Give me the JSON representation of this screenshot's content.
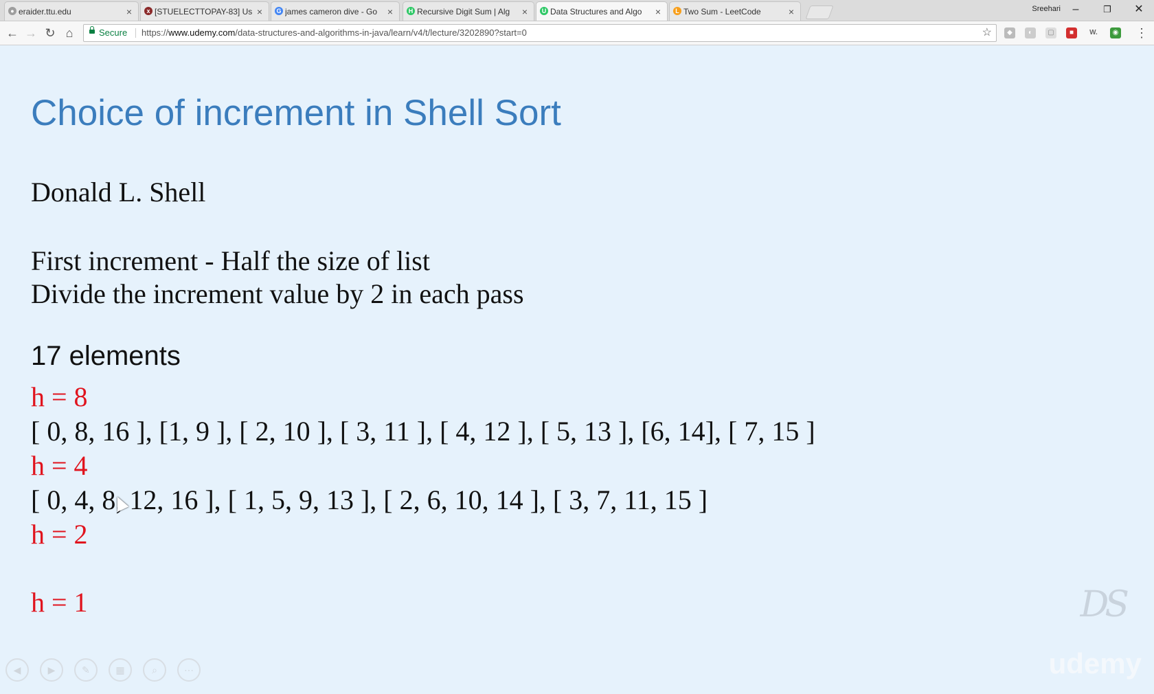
{
  "tabs": [
    {
      "title": "eraider.ttu.edu",
      "favicon": "#9e9e9e"
    },
    {
      "title": "[STUELECTTOPAY-83] Us",
      "favicon": "#8b2a2a"
    },
    {
      "title": "james cameron dive - Go",
      "favicon": "#4285f4"
    },
    {
      "title": "Recursive Digit Sum | Alg",
      "favicon": "#2ec866"
    },
    {
      "title": "Data Structures and Algo",
      "favicon": "#2ec866",
      "active": true
    },
    {
      "title": "Two Sum - LeetCode",
      "favicon": "#f89f1b"
    }
  ],
  "profile_name": "Sreehari",
  "window_controls": {
    "minimize": "–",
    "restore": "❐",
    "close": "✕"
  },
  "toolbar": {
    "secure_label": "Secure",
    "url_prefix": "https://",
    "url_host": "www.udemy.com",
    "url_path": "/data-structures-and-algorithms-in-java/learn/v4/t/lecture/3202890?start=0"
  },
  "slide": {
    "title": "Choice of increment in Shell Sort",
    "author": "Donald L. Shell",
    "rule1": "First increment - Half the size of list",
    "rule2": "Divide the increment value by 2 in each pass",
    "count": "17 elements",
    "h8": "h = 8",
    "groups8": "[ 0, 8, 16 ],  [1, 9 ],  [ 2, 10 ],  [ 3, 11 ],  [ 4, 12 ],  [ 5, 13 ],  [6, 14],  [ 7, 15 ]",
    "h4": "h = 4",
    "groups4": "[ 0, 4, 8, 12, 16 ],   [ 1, 5, 9, 13 ],   [ 2, 6, 10, 14 ],   [ 3, 7, 11, 15 ]",
    "h2": "h = 2",
    "h1": "h = 1",
    "watermark": "DS",
    "brand": "udemy"
  },
  "colors": {
    "title": "#3b7dbd",
    "h_value": "#e0141e",
    "background": "#e6f2fc"
  }
}
